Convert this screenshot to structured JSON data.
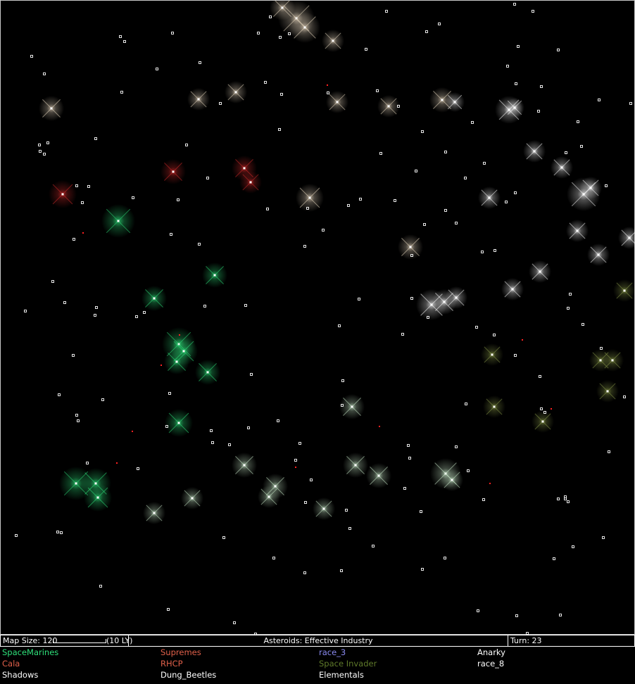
{
  "status_bar": {
    "map_size_label": "Map Size: 120",
    "scale_label": "(10 LY)",
    "center_text": "Asteroids: Effective Industry",
    "turn_label": "Turn: 23"
  },
  "races": [
    {
      "name": "SpaceMarines",
      "color": "#2ee07a"
    },
    {
      "name": "Supremes",
      "color": "#e0604a"
    },
    {
      "name": "race_3",
      "color": "#8a8af0"
    },
    {
      "name": "Anarky",
      "color": "#ffffff"
    },
    {
      "name": "Cala",
      "color": "#e0604a"
    },
    {
      "name": "RHCP",
      "color": "#e0604a"
    },
    {
      "name": "Space Invader",
      "color": "#5f7a2a"
    },
    {
      "name": "race_8",
      "color": "#ffffff"
    },
    {
      "name": "Shadows",
      "color": "#ffffff"
    },
    {
      "name": "Dung_Beetles",
      "color": "#ffffff"
    },
    {
      "name": "Elementals",
      "color": "#ffffff"
    }
  ],
  "colors": {
    "green_systems": "#2ee07a",
    "red_systems": "#d02a2a",
    "white_systems": "#ffffff",
    "pale_green_systems": "#c8e8c8",
    "olive_systems": "#8a9a4a",
    "beige_systems": "#e8d8c0",
    "unowned_star": "#ffffff",
    "fleet_dot": "#ff2020"
  }
}
